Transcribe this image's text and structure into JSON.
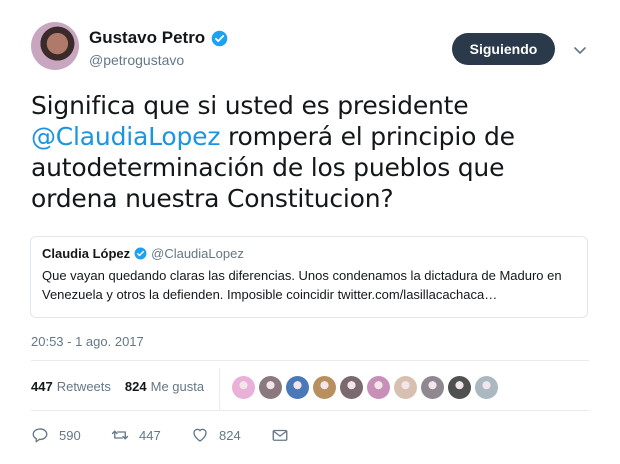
{
  "tweet": {
    "author_name": "Gustavo Petro",
    "author_handle": "@petrogustavo",
    "follow_label": "Siguiendo",
    "text_before": "Significa que si usted es presidente ",
    "mention": "@ClaudiaLopez",
    "text_after": " romperá el principio de autodeterminación de los pueblos que ordena nuestra Constitucion?",
    "timestamp": "20:53 - 1 ago. 2017"
  },
  "quote": {
    "name": "Claudia López",
    "handle": "@ClaudiaLopez",
    "text": "Que vayan quedando claras las diferencias. Unos condenamos la dictadura de Maduro en Venezuela y otros la defienden. Imposible coincidir twitter.com/lasillacachaca…"
  },
  "stats": {
    "retweets_count": "447",
    "retweets_label": "Retweets",
    "likes_count": "824",
    "likes_label": "Me gusta"
  },
  "actions": {
    "reply_count": "590",
    "retweet_count": "447",
    "like_count": "824"
  },
  "colors": {
    "accent": "#1b95e0",
    "follow_button": "#2b3a4a",
    "muted_text": "#657786",
    "divider": "#e6ecf0"
  },
  "likers": [
    {
      "icon": "avatar-1",
      "color": "#e9b0d8"
    },
    {
      "icon": "avatar-2",
      "color": "#8a7a80"
    },
    {
      "icon": "avatar-3",
      "color": "#4a78b8"
    },
    {
      "icon": "avatar-4",
      "color": "#b89060"
    },
    {
      "icon": "avatar-5",
      "color": "#7a6a70"
    },
    {
      "icon": "avatar-6",
      "color": "#c890b8"
    },
    {
      "icon": "avatar-7",
      "color": "#d8c0b0"
    },
    {
      "icon": "avatar-8",
      "color": "#908890"
    },
    {
      "icon": "avatar-9",
      "color": "#505050"
    },
    {
      "icon": "avatar-10",
      "color": "#aab8c2"
    }
  ]
}
